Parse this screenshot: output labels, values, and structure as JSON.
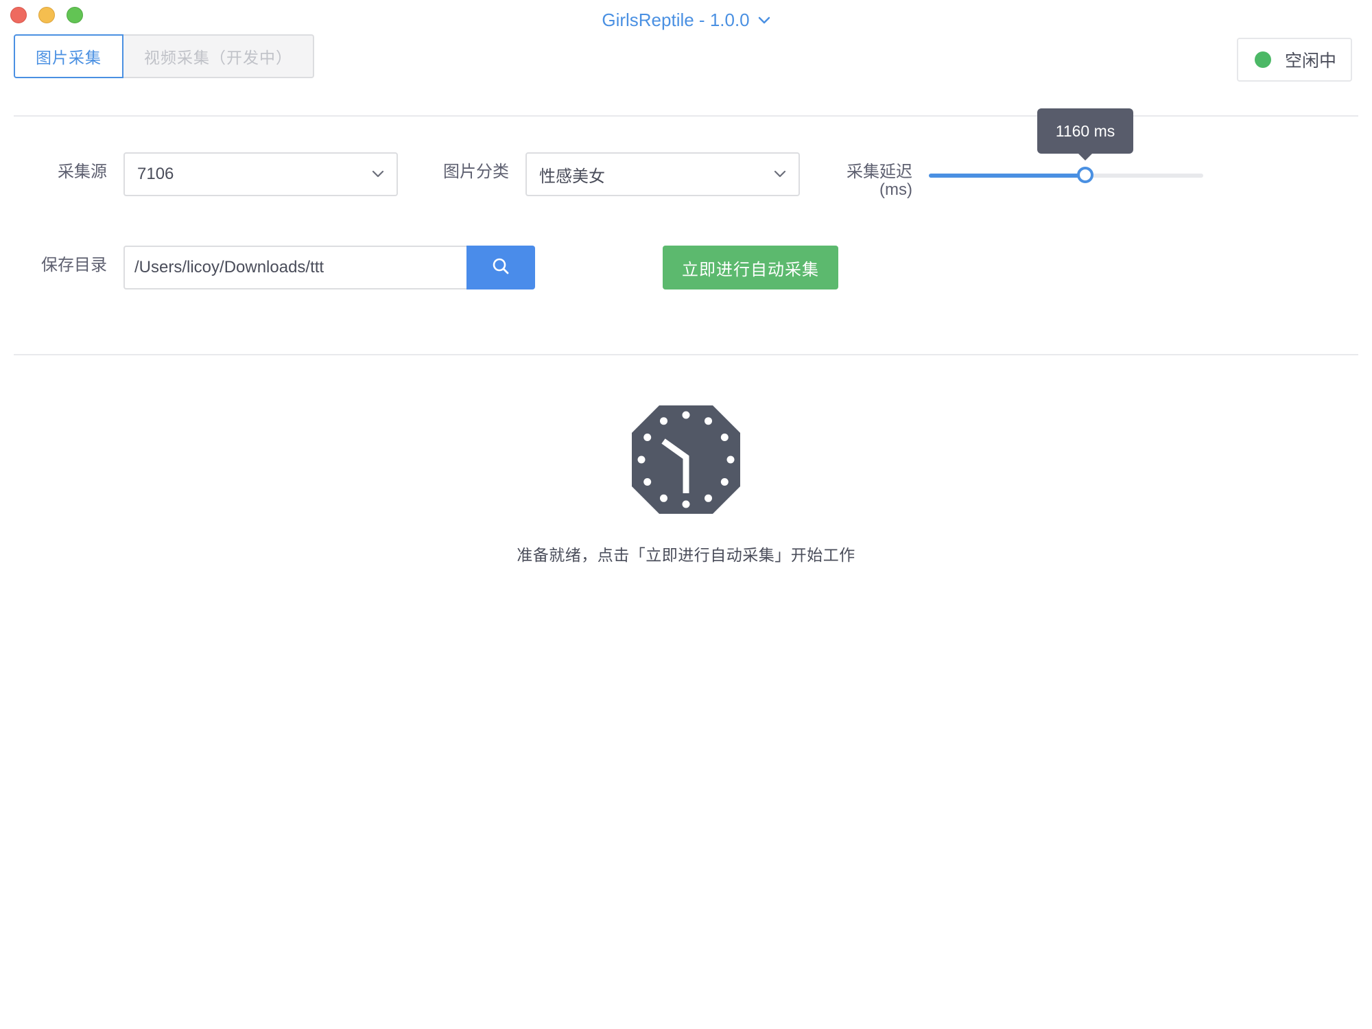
{
  "window": {
    "title": "GirlsReptile - 1.0.0"
  },
  "tabs": [
    {
      "label": "图片采集",
      "active": true
    },
    {
      "label": "视频采集（开发中）",
      "active": false,
      "disabled": true
    }
  ],
  "status": {
    "label": "空闲中",
    "color": "#4cb866"
  },
  "form": {
    "source": {
      "label": "采集源",
      "value": "7106"
    },
    "category": {
      "label": "图片分类",
      "value": "性感美女"
    },
    "delay": {
      "label_line1": "采集延迟",
      "label_line2": "(ms)",
      "fraction": 0.57,
      "tooltip": "1160 ms"
    },
    "save_dir": {
      "label": "保存目录",
      "value": "/Users/licoy/Downloads/ttt"
    },
    "start_button": "立即进行自动采集"
  },
  "empty_state": {
    "icon": "clock-icon",
    "message": "准备就绪，点击「立即进行自动采集」开始工作"
  },
  "colors": {
    "accent": "#4a90e2",
    "success": "#5cb96e",
    "tooltip_bg": "#585c6b"
  }
}
